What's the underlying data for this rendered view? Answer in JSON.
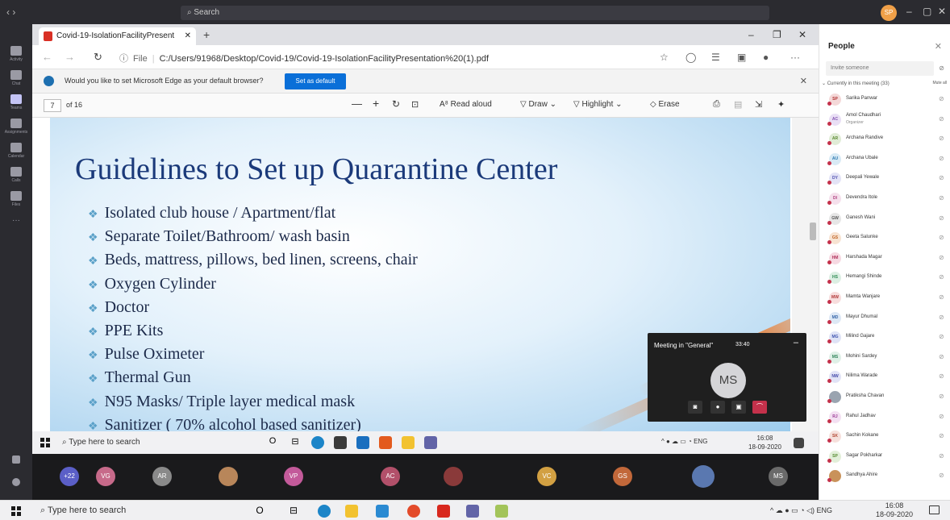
{
  "teams": {
    "search_placeholder": "Search",
    "top_avatar": "SP",
    "rail": [
      {
        "label": "Activity"
      },
      {
        "label": "Chat"
      },
      {
        "label": "Teams"
      },
      {
        "label": "Assignments"
      },
      {
        "label": "Calendar"
      },
      {
        "label": "Calls"
      },
      {
        "label": "Files"
      }
    ]
  },
  "browser": {
    "tab_title": "Covid-19-IsolationFacilityPresent",
    "address_scheme": "File",
    "address": "C:/Users/91968/Desktop/Covid-19/Covid-19-IsolationFacilityPresentation%20(1).pdf",
    "banner_text": "Would you like to set Microsoft Edge as your default browser?",
    "banner_button": "Set as default"
  },
  "pdf_toolbar": {
    "page": "7",
    "of": "of 16",
    "read_aloud": "Read aloud",
    "draw": "Draw",
    "highlight": "Highlight",
    "erase": "Erase"
  },
  "slide": {
    "title": "Guidelines to Set up Quarantine Center",
    "bullets": [
      "Isolated club house / Apartment/flat",
      "Separate Toilet/Bathroom/ wash basin",
      "Beds, mattress, pillows, bed linen, screens, chair",
      "Oxygen Cylinder",
      "Doctor",
      "PPE Kits",
      "Pulse Oximeter",
      "Thermal Gun",
      "N95 Masks/ Triple layer medical mask",
      "Sanitizer ( 70% alcohol based sanitizer)"
    ]
  },
  "inner_taskbar": {
    "search": "Type here to search",
    "lang": "ENG",
    "time": "16:08",
    "date": "18-09-2020"
  },
  "meeting": {
    "title": "Meeting in \"General\"",
    "elapsed": "33:40",
    "avatar": "MS"
  },
  "strip": {
    "overflow": "+22",
    "participants": [
      "VG",
      "AR",
      "VP",
      "AC",
      "VC",
      "GS",
      "MS"
    ]
  },
  "people": {
    "title": "People",
    "invite_placeholder": "Invite someone",
    "section": "Currently in this meeting (33)",
    "mute_all": "Mute all",
    "list": [
      {
        "initials": "SP",
        "name": "Sarika Panwar",
        "color": "#f4d8d8",
        "fg": "#b03030"
      },
      {
        "initials": "AC",
        "name": "Amol Chaudhari",
        "role": "Organizer",
        "color": "#e9dff5",
        "fg": "#8050b0"
      },
      {
        "initials": "AR",
        "name": "Archana Randive",
        "color": "#e0ecd6",
        "fg": "#5a8a30"
      },
      {
        "initials": "AU",
        "name": "Archana Ubale",
        "color": "#d8eaf5",
        "fg": "#2a78b0"
      },
      {
        "initials": "DY",
        "name": "Deepali Yewale",
        "color": "#e3e3f6",
        "fg": "#5050b0"
      },
      {
        "initials": "DI",
        "name": "Devendra Itole",
        "color": "#f5e0ec",
        "fg": "#b04080"
      },
      {
        "initials": "GW",
        "name": "Ganesh Wani",
        "color": "#e6e6e6",
        "fg": "#555555"
      },
      {
        "initials": "GS",
        "name": "Geeta Salunke",
        "color": "#f7e3d2",
        "fg": "#c06020"
      },
      {
        "initials": "HM",
        "name": "Harshada Magar",
        "color": "#f6d9e2",
        "fg": "#b0305a"
      },
      {
        "initials": "HS",
        "name": "Hemangi Shinde",
        "color": "#dcefe3",
        "fg": "#2a8a50"
      },
      {
        "initials": "MW",
        "name": "Mamta Wanjare",
        "color": "#f7dddd",
        "fg": "#b03535"
      },
      {
        "initials": "MD",
        "name": "Mayur Dhumal",
        "color": "#dde8f5",
        "fg": "#3565a8"
      },
      {
        "initials": "MG",
        "name": "Milind Gajare",
        "color": "#dfe3f6",
        "fg": "#3f55b0"
      },
      {
        "initials": "MS",
        "name": "Mohini Sardey",
        "color": "#dff0e7",
        "fg": "#30855a"
      },
      {
        "initials": "NW",
        "name": "Nilima Warade",
        "color": "#e1e3f6",
        "fg": "#4048a8"
      },
      {
        "initials": "",
        "name": "Pratiksha Chavan",
        "color": "#9aa4b0",
        "fg": "#ffffff"
      },
      {
        "initials": "RJ",
        "name": "Rahul Jadhav",
        "color": "#f3e0f2",
        "fg": "#9a3a95"
      },
      {
        "initials": "SK",
        "name": "Sachin Kokane",
        "color": "#f6e0dc",
        "fg": "#b04530"
      },
      {
        "initials": "SP",
        "name": "Sagar Pokharkar",
        "color": "#e2efd9",
        "fg": "#558a30"
      },
      {
        "initials": "",
        "name": "Sandhya Ahire",
        "color": "#c9925a",
        "fg": "#ffffff"
      }
    ]
  },
  "taskbar": {
    "search": "Type here to search",
    "lang": "ENG",
    "time": "16:08",
    "date": "18-09-2020"
  }
}
